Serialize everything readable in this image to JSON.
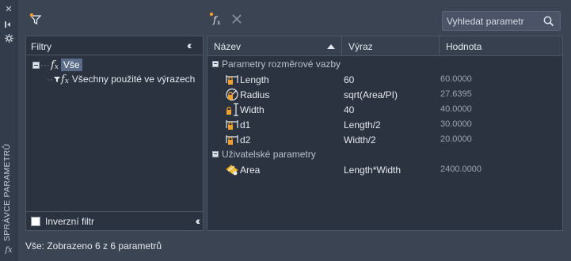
{
  "palette_title": "SPRÁVCE PARAMETRŮ",
  "palette_fx": "fx",
  "toolbar": {
    "search_placeholder": "Vyhledat parametr"
  },
  "filters": {
    "title": "Filtry",
    "tree": [
      {
        "label": "Vše",
        "selected": true
      },
      {
        "label": "Všechny použité ve výrazech",
        "selected": false
      }
    ],
    "invert_label": "Inverzní filtr"
  },
  "table": {
    "columns": [
      "Název",
      "Výraz",
      "Hodnota"
    ],
    "groups": [
      {
        "label": "Parametry rozměrové vazby",
        "rows": [
          {
            "icon": "linear-dimension-icon",
            "name": "Length",
            "expression": "60",
            "value": "60.0000"
          },
          {
            "icon": "radius-dimension-icon",
            "name": "Radius",
            "expression": "sqrt(Area/PI)",
            "value": "27.6395"
          },
          {
            "icon": "vertical-dimension-icon",
            "name": "Width",
            "expression": "40",
            "value": "40.0000"
          },
          {
            "icon": "linear-dimension-icon",
            "name": "d1",
            "expression": "Length/2",
            "value": "30.0000"
          },
          {
            "icon": "linear-dimension-icon",
            "name": "d2",
            "expression": "Width/2",
            "value": "20.0000"
          }
        ]
      },
      {
        "label": "Uživatelské parametry",
        "rows": [
          {
            "icon": "user-parameter-icon",
            "name": "Area",
            "expression": "Length*Width",
            "value": "2400.0000"
          }
        ]
      }
    ]
  },
  "status": "Vše: Zobrazeno 6 z 6 parametrů"
}
